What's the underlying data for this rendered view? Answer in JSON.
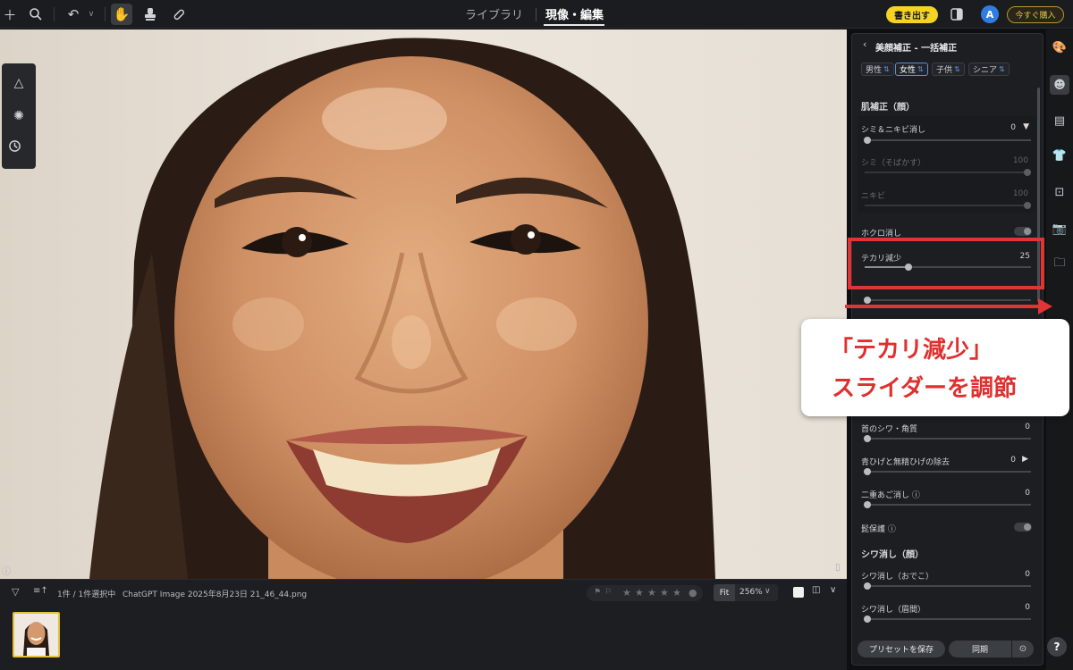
{
  "topbar": {
    "tab_library": "ライブラリ",
    "tab_develop": "現像・編集",
    "export_label": "書き出す",
    "avatar_letter": "A",
    "buy_label": "今すぐ購入"
  },
  "filmstrip": {
    "selection_count": "1件 / 1件選択中",
    "filename": "ChatGPT Image 2025年8月23日 21_46_44.png",
    "zoom_fit": "Fit",
    "zoom_value": "256%"
  },
  "panel": {
    "title": "美顔補正 - 一括補正",
    "chips": [
      "男性",
      "女性",
      "子供",
      "シニア"
    ],
    "section_skin": "肌補正（顔）",
    "spot_acne_label": "シミ＆ニキビ消し",
    "spot_acne_value": "0",
    "freckles_label": "シミ（そばかす）",
    "freckles_value": "100",
    "acne_label": "ニキビ",
    "acne_value": "100",
    "mole_label": "ホクロ消し",
    "shine_label": "テカリ減少",
    "shine_value": "25",
    "neck_wrinkle_label": "首のシワ・角質",
    "neck_wrinkle_value": "0",
    "beard_label": "青ひげと無精ひげの除去",
    "beard_value": "0",
    "double_chin_label": "二重あご消し ⓘ",
    "double_chin_value": "0",
    "hair_protect_label": "髭保護 ⓘ",
    "section_wrinkle": "シワ消し（顔）",
    "forehead_label": "シワ消し（おでこ）",
    "forehead_value": "0",
    "brow_label": "シワ消し（眉間）",
    "brow_value": "0",
    "save_preset_label": "プリセットを保存",
    "sync_label": "同期"
  },
  "annotation": {
    "line1": "「テカリ減少」",
    "line2": "スライダーを調節",
    "color": "#e13434"
  },
  "values": {
    "shine_fraction": 0.25,
    "freckles_fraction": 1.0,
    "acne_fraction": 1.0
  }
}
